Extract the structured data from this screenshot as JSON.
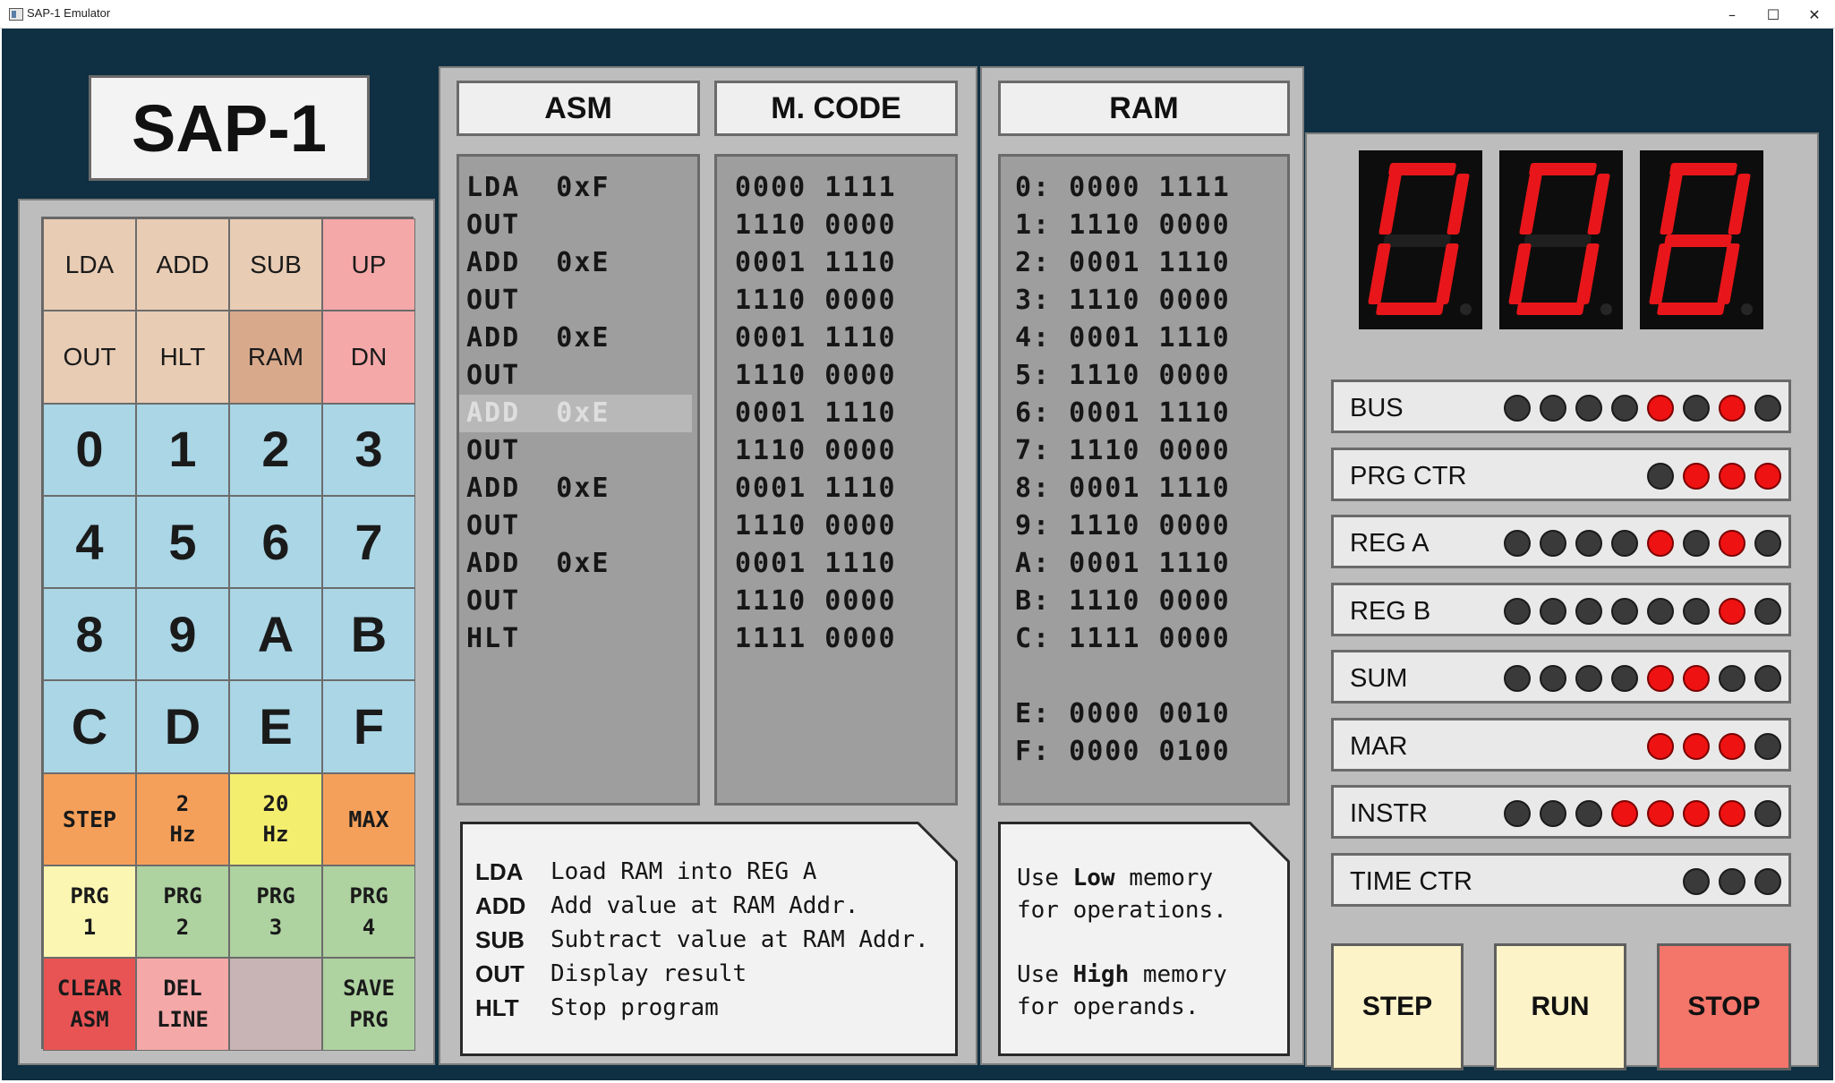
{
  "window": {
    "title": "SAP-1 Emulator",
    "minimize": "–",
    "maximize": "☐",
    "close": "✕"
  },
  "logo": "SAP-1",
  "keypad": [
    {
      "label": "LDA",
      "style": "instr"
    },
    {
      "label": "ADD",
      "style": "instr"
    },
    {
      "label": "SUB",
      "style": "instr"
    },
    {
      "label": "UP",
      "style": "nav"
    },
    {
      "label": "OUT",
      "style": "instr"
    },
    {
      "label": "HLT",
      "style": "instr"
    },
    {
      "label": "RAM",
      "style": "ram"
    },
    {
      "label": "DN",
      "style": "nav"
    },
    {
      "label": "0",
      "style": "hex"
    },
    {
      "label": "1",
      "style": "hex"
    },
    {
      "label": "2",
      "style": "hex"
    },
    {
      "label": "3",
      "style": "hex"
    },
    {
      "label": "4",
      "style": "hex"
    },
    {
      "label": "5",
      "style": "hex"
    },
    {
      "label": "6",
      "style": "hex"
    },
    {
      "label": "7",
      "style": "hex"
    },
    {
      "label": "8",
      "style": "hex"
    },
    {
      "label": "9",
      "style": "hex"
    },
    {
      "label": "A",
      "style": "hex"
    },
    {
      "label": "B",
      "style": "hex"
    },
    {
      "label": "C",
      "style": "hex"
    },
    {
      "label": "D",
      "style": "hex"
    },
    {
      "label": "E",
      "style": "hex"
    },
    {
      "label": "F",
      "style": "hex"
    },
    {
      "label": "STEP",
      "style": "orange"
    },
    {
      "label": "2\nHz",
      "style": "orange"
    },
    {
      "label": "20\nHz",
      "style": "yellow"
    },
    {
      "label": "MAX",
      "style": "orange"
    },
    {
      "label": "PRG\n1",
      "style": "prg1"
    },
    {
      "label": "PRG\n2",
      "style": "prg"
    },
    {
      "label": "PRG\n3",
      "style": "prg"
    },
    {
      "label": "PRG\n4",
      "style": "prg"
    },
    {
      "label": "CLEAR\nASM",
      "style": "clear"
    },
    {
      "label": "DEL\nLINE",
      "style": "del"
    },
    {
      "label": "",
      "style": "blank"
    },
    {
      "label": "SAVE\nPRG",
      "style": "save"
    }
  ],
  "editor": {
    "asm_header": "ASM",
    "mcode_header": "M. CODE",
    "selected_line": 6,
    "asm": [
      "LDA  0xF",
      "OUT",
      "ADD  0xE",
      "OUT",
      "ADD  0xE",
      "OUT",
      "ADD  0xE",
      "OUT",
      "ADD  0xE",
      "OUT",
      "ADD  0xE",
      "OUT",
      "HLT"
    ],
    "mcode": [
      "0000 1111",
      "1110 0000",
      "0001 1110",
      "1110 0000",
      "0001 1110",
      "1110 0000",
      "0001 1110",
      "1110 0000",
      "0001 1110",
      "1110 0000",
      "0001 1110",
      "1110 0000",
      "1111 0000"
    ],
    "help": [
      {
        "key": "LDA",
        "text": "Load RAM into REG A"
      },
      {
        "key": "ADD",
        "text": "Add value at RAM Addr."
      },
      {
        "key": "SUB",
        "text": "Subtract value at RAM Addr."
      },
      {
        "key": "OUT",
        "text": "Display result"
      },
      {
        "key": "HLT",
        "text": "Stop program"
      }
    ]
  },
  "ram": {
    "header": "RAM",
    "lines": [
      "0: 0000 1111",
      "1: 1110 0000",
      "2: 0001 1110",
      "3: 1110 0000",
      "4: 0001 1110",
      "5: 1110 0000",
      "6: 0001 1110",
      "7: 1110 0000",
      "8: 0001 1110",
      "9: 1110 0000",
      "A: 0001 1110",
      "B: 1110 0000",
      "C: 1111 0000",
      "",
      "E: 0000 0010",
      "F: 0000 0100"
    ],
    "note": {
      "l1_pre": "Use ",
      "l1_bold": "Low",
      "l1_post": " memory",
      "l2": "for operations.",
      "l3_pre": "Use ",
      "l3_bold": "High",
      "l3_post": " memory",
      "l4": "for operands."
    }
  },
  "display": {
    "digits": [
      "0",
      "0",
      "8"
    ],
    "segment_color": "#e8161a"
  },
  "registers": [
    {
      "name": "BUS",
      "bits": [
        0,
        0,
        0,
        0,
        1,
        0,
        1,
        0
      ]
    },
    {
      "name": "PRG CTR",
      "bits": [
        0,
        1,
        1,
        1
      ]
    },
    {
      "name": "REG A",
      "bits": [
        0,
        0,
        0,
        0,
        1,
        0,
        1,
        0
      ]
    },
    {
      "name": "REG B",
      "bits": [
        0,
        0,
        0,
        0,
        0,
        0,
        1,
        0
      ]
    },
    {
      "name": "SUM",
      "bits": [
        0,
        0,
        0,
        0,
        1,
        1,
        0,
        0
      ]
    },
    {
      "name": "MAR",
      "bits": [
        1,
        1,
        1,
        0
      ]
    },
    {
      "name": "INSTR",
      "bits": [
        0,
        0,
        0,
        1,
        1,
        1,
        1,
        0
      ]
    },
    {
      "name": "TIME CTR",
      "bits": [
        0,
        0,
        0
      ]
    }
  ],
  "controls": {
    "step": "STEP",
    "run": "RUN",
    "stop": "STOP"
  }
}
